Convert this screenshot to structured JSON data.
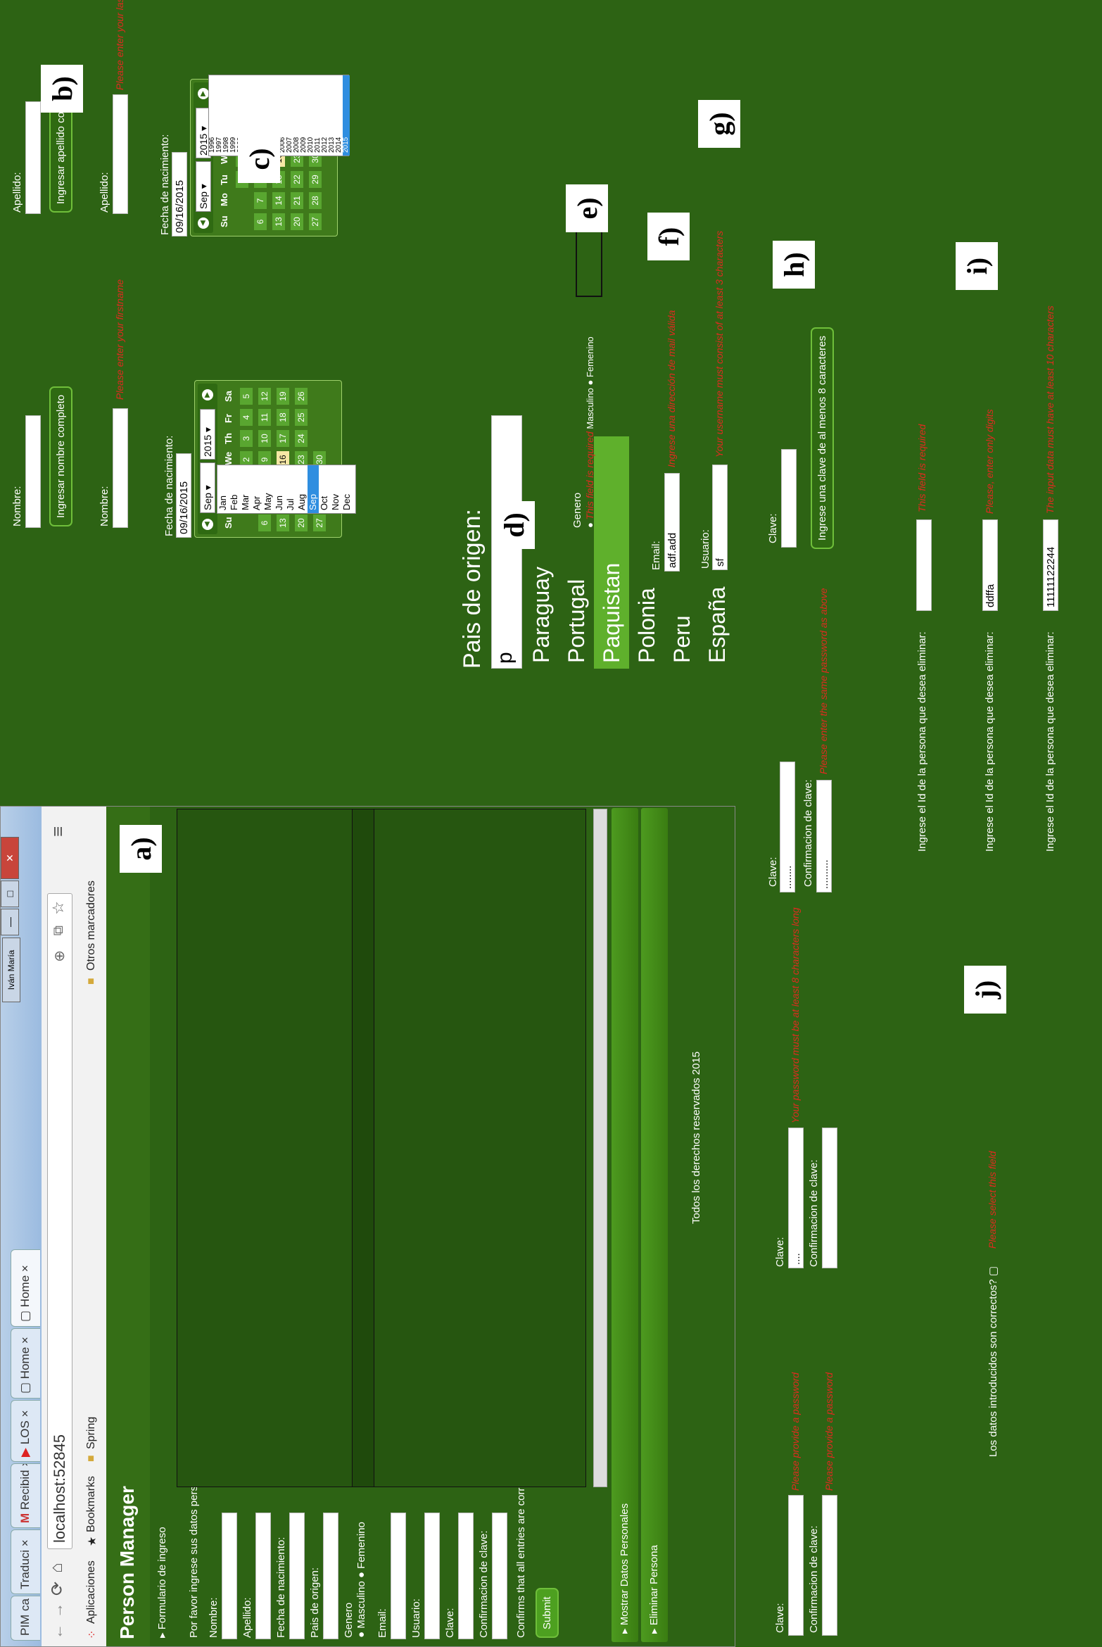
{
  "panel_tags": {
    "a": "a)",
    "b": "b)",
    "c": "c)",
    "d": "d)",
    "e": "e)",
    "f": "f)",
    "g": "g)",
    "h": "h)",
    "i": "i)",
    "j": "j)"
  },
  "browser": {
    "tabs": [
      "PIM ca",
      "Traduci",
      "Recibid",
      "LOS",
      "Home",
      "Home"
    ],
    "user_button": "Iván María",
    "window_controls": [
      "—",
      "□",
      "✕"
    ],
    "url": "localhost:52845",
    "bookmarks": {
      "apps": "Aplicaciones",
      "bookmarks": "Bookmarks",
      "spring": "Spring",
      "other": "Otros marcadores"
    }
  },
  "app": {
    "title": "Person Manager",
    "form_header": "Formulario de ingreso",
    "intro": "Por favor ingrese sus datos personales",
    "labels": {
      "nombre": "Nombre:",
      "apellido": "Apellido:",
      "fecha": "Fecha de nacimiento:",
      "pais": "Pais de origen:",
      "genero": "Genero",
      "masculino": "Masculino",
      "femenino": "Femenino",
      "email": "Email:",
      "usuario": "Usuario:",
      "clave": "Clave:",
      "confirmacion": "Confirmacion de clave:",
      "confirm_check": "Confirms that all entries are correct?"
    },
    "submit": "Submit",
    "mostrar": "Mostrar Datos Personales",
    "eliminar": "Eliminar Persona",
    "footer": "Todos los derechos reservados 2015"
  },
  "panel_b": {
    "nombre_label": "Nombre:",
    "nombre_button": "Ingresar nombre completo",
    "nombre_label2": "Nombre:",
    "nombre_error": "Please enter your firstname",
    "apellido_label": "Apellido:",
    "apellido_button": "Ingresar apellido completo",
    "apellido_label2": "Apellido:",
    "apellido_error": "Please enter your lastname"
  },
  "panel_c": {
    "label": "Fecha de nacimiento:",
    "value": "09/16/2015",
    "month": "Sep",
    "year": "2015",
    "days_of_week": [
      "Su",
      "Mo",
      "Tu",
      "We",
      "Th",
      "Fr",
      "Sa"
    ],
    "month_options": [
      "Jan",
      "Feb",
      "Mar",
      "Apr",
      "May",
      "Jun",
      "Jul",
      "Aug",
      "Sep",
      "Oct",
      "Nov",
      "Dec"
    ],
    "year_options": [
      "1996",
      "1997",
      "1998",
      "1999",
      "2000",
      "2001",
      "2002",
      "2003",
      "2004",
      "2005",
      "2006",
      "2007",
      "2008",
      "2009",
      "2010",
      "2011",
      "2012",
      "2013",
      "2014",
      "2015"
    ],
    "weeks": [
      [
        "",
        "",
        "1",
        "2",
        "3",
        "4",
        "5"
      ],
      [
        "6",
        "7",
        "8",
        "9",
        "10",
        "11",
        "12"
      ],
      [
        "13",
        "14",
        "15",
        "16",
        "17",
        "18",
        "19"
      ],
      [
        "20",
        "21",
        "22",
        "23",
        "24",
        "25",
        "26"
      ],
      [
        "27",
        "28",
        "29",
        "30",
        "",
        "",
        ""
      ]
    ]
  },
  "panel_d": {
    "title": "Pais de origen:",
    "input_value": "p",
    "suggestions": [
      "Paraguay",
      "Portugal",
      "Paquistan",
      "Polonia",
      "Peru",
      "España"
    ],
    "highlighted": "Paquistan"
  },
  "panel_e": {
    "label": "Genero",
    "error": "This field is required",
    "masculino": "Masculino",
    "femenino": "Femenino"
  },
  "panel_f": {
    "label": "Email:",
    "value": "adf.add",
    "error": "Ingrese una dirección de mail válida"
  },
  "panel_g": {
    "label": "Usuario:",
    "value": "sf",
    "error": "Your username must consist of at least 3 characters"
  },
  "panel_h": {
    "clave1_label": "Clave:",
    "clave1_value": "........",
    "confirm1_label": "Confirmacion de clave:",
    "confirm1_value": "..........",
    "confirm1_error": "Please enter the same password as above",
    "clave2_label": "Clave:",
    "button": "Ingrese una clave de al menos 8 caracteres"
  },
  "panel_i": {
    "label": "Ingrese el Id de la persona que desea eliminar:",
    "error1": "This field is required",
    "value2": "ddffa",
    "error2": "Please, enter only digits",
    "value3": "11111122244",
    "error3": "The input data must have at least 10 characters"
  },
  "panel_j": {
    "clave_label": "Clave:",
    "clave_error": "Please provide a password",
    "confirm_label": "Confirmacion de clave:",
    "confirm_error": "Please provide a password",
    "clave2_label": "Clave:",
    "clave2_value": "....",
    "clave2_error": "Your password must be at least 8 characters long",
    "confirm2_label": "Confirmacion de clave:",
    "check_label": "Los datos introducidos son correctos?",
    "check_error": "Please select this field"
  }
}
